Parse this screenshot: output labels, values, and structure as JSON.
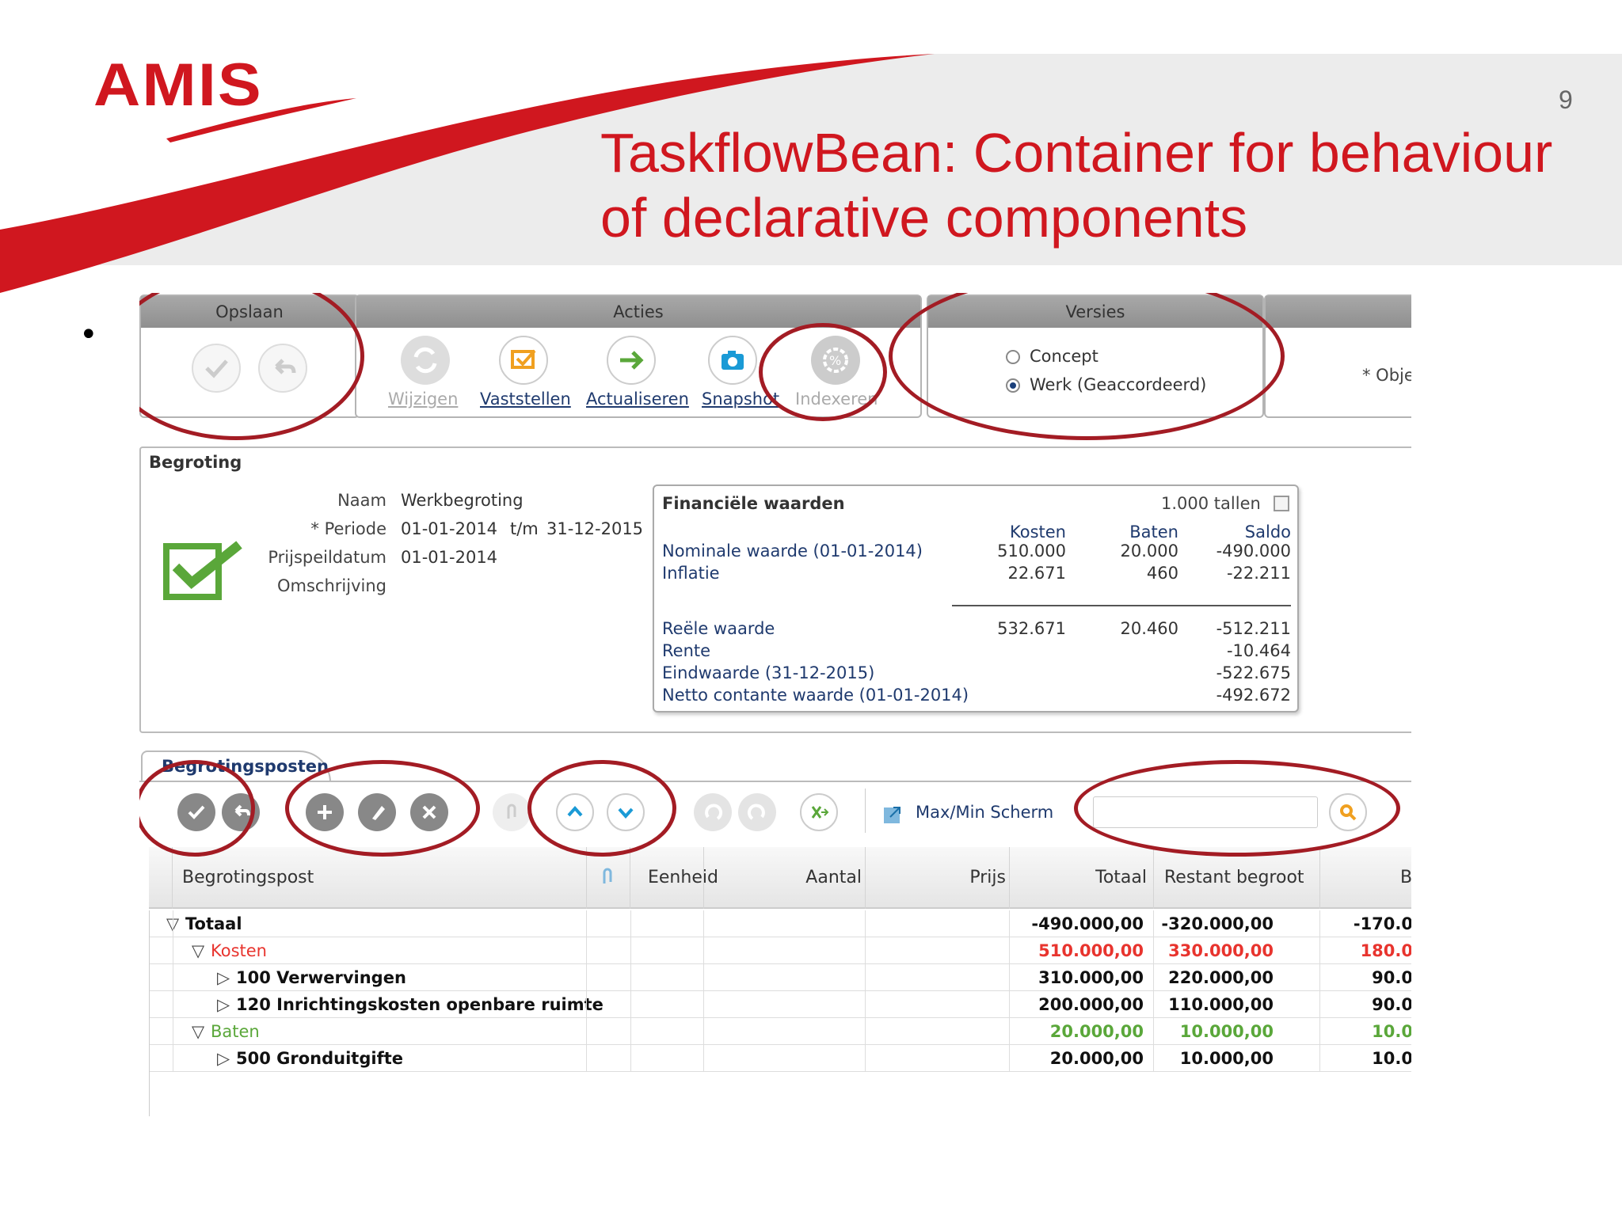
{
  "slide": {
    "logo": "AMIS",
    "page_number": "9",
    "title_line1": "TaskflowBean: Container for behaviour",
    "title_line2": "of declarative components",
    "bullet": "•"
  },
  "colors": {
    "brand_red": "#d0171f",
    "ring": "#a31c24",
    "link": "#1f3a6e",
    "negative": "#e8342e",
    "positive": "#5aa73a"
  },
  "toolbar": {
    "opslaan": {
      "header": "Opslaan",
      "buttons": [
        {
          "icon": "check-icon"
        },
        {
          "icon": "undo-icon"
        }
      ]
    },
    "acties": {
      "header": "Acties",
      "buttons": [
        {
          "label": "Wijzigen",
          "icon": "refresh-icon",
          "enabled": false
        },
        {
          "label": "Vaststellen",
          "icon": "approve-icon",
          "enabled": true
        },
        {
          "label": "Actualiseren",
          "icon": "arrow-right-icon",
          "enabled": true
        },
        {
          "label": "Snapshot",
          "icon": "camera-icon",
          "enabled": true
        },
        {
          "label": "Indexeren",
          "icon": "percent-gear-icon",
          "enabled": false
        }
      ]
    },
    "versies": {
      "header": "Versies",
      "options": [
        "Concept",
        "Werk (Geaccordeerd)"
      ],
      "selected": "Werk (Geaccordeerd)"
    },
    "extra": {
      "label": "* Obje"
    }
  },
  "begroting": {
    "section_title": "Begroting",
    "naam_label": "Naam",
    "naam": "Werkbegroting",
    "periode_label": "* Periode",
    "periode_from": "01-01-2014",
    "periode_tm": "t/m",
    "periode_to": "31-12-2015",
    "prijspeil_label": "Prijspeildatum",
    "prijspeil": "01-01-2014",
    "omschrijving_label": "Omschrijving",
    "status_icon": "checkmark-status-icon"
  },
  "financien": {
    "title": "Financiële waarden",
    "tallen_label": "1.000 tallen",
    "cols": [
      "Kosten",
      "Baten",
      "Saldo"
    ],
    "rows": [
      {
        "label": "Nominale waarde (01-01-2014)",
        "kosten": "510.000",
        "baten": "20.000",
        "saldo": "-490.000"
      },
      {
        "label": "Inflatie",
        "kosten": "22.671",
        "baten": "460",
        "saldo": "-22.211"
      },
      {
        "label": "Reële waarde",
        "kosten": "532.671",
        "baten": "20.460",
        "saldo": "-512.211"
      },
      {
        "label": "Rente",
        "kosten": "",
        "baten": "",
        "saldo": "-10.464"
      },
      {
        "label": "Eindwaarde (31-12-2015)",
        "kosten": "",
        "baten": "",
        "saldo": "-522.675"
      },
      {
        "label": "Netto contante waarde (01-01-2014)",
        "kosten": "",
        "baten": "",
        "saldo": "-492.672"
      }
    ]
  },
  "posten": {
    "tab": "Begrotingsposten",
    "maxmin": "Max/Min Scherm",
    "search_placeholder": "",
    "headers": {
      "post": "Begrotingspost",
      "eenheid": "Eenheid",
      "aantal": "Aantal",
      "prijs": "Prijs",
      "totaal": "Totaal",
      "restant": "Restant begroot",
      "b": "B"
    },
    "rows": [
      {
        "name": "Totaal",
        "toggle": "▽",
        "level": 0,
        "style": "bold",
        "totaal": "-490.000,00",
        "restant": "-320.000,00",
        "b": "-170.0"
      },
      {
        "name": "Kosten",
        "toggle": "▽",
        "level": 1,
        "style": "negative",
        "totaal": "510.000,00",
        "restant": "330.000,00",
        "b": "180.0"
      },
      {
        "name": "100 Verwervingen",
        "toggle": "▷",
        "level": 2,
        "style": "bold",
        "totaal": "310.000,00",
        "restant": "220.000,00",
        "b": "90.0"
      },
      {
        "name": "120 Inrichtingskosten openbare ruimte",
        "toggle": "▷",
        "level": 2,
        "style": "bold",
        "totaal": "200.000,00",
        "restant": "110.000,00",
        "b": "90.0"
      },
      {
        "name": "Baten",
        "toggle": "▽",
        "level": 1,
        "style": "positive",
        "totaal": "20.000,00",
        "restant": "10.000,00",
        "b": "10.0"
      },
      {
        "name": "500 Gronduitgifte",
        "toggle": "▷",
        "level": 2,
        "style": "bold",
        "totaal": "20.000,00",
        "restant": "10.000,00",
        "b": "10.0"
      }
    ]
  }
}
